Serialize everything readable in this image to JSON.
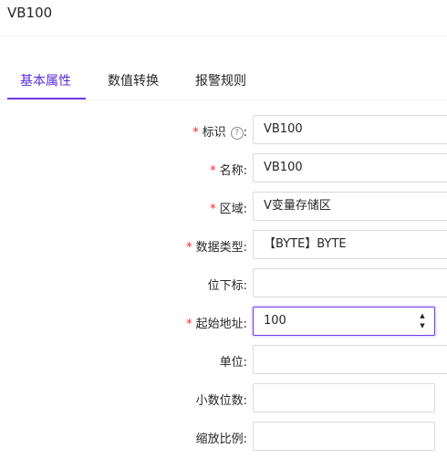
{
  "header": {
    "title": "VB100"
  },
  "tabs": [
    {
      "label": "基本属性",
      "active": true
    },
    {
      "label": "数值转换",
      "active": false
    },
    {
      "label": "报警规则",
      "active": false
    }
  ],
  "form": {
    "required_mark": "*",
    "label_suffix": ":",
    "help_icon": "?",
    "fields": [
      {
        "label": "标识",
        "value": "VB100"
      },
      {
        "label": "名称",
        "value": "VB100"
      },
      {
        "label": "区域",
        "value": "V变量存储区"
      },
      {
        "label": "数据类型",
        "value": "【BYTE】BYTE"
      },
      {
        "label": "位下标",
        "value": ""
      },
      {
        "label": "起始地址",
        "value": "100"
      },
      {
        "label": "单位",
        "value": ""
      },
      {
        "label": "小数位数",
        "value": ""
      },
      {
        "label": "缩放比例",
        "value": ""
      }
    ]
  },
  "stepper": {
    "up": "▲",
    "down": "▼"
  },
  "colors": {
    "accent": "#6d3be8",
    "required": "#f5222d",
    "border": "#d9d9d9"
  }
}
